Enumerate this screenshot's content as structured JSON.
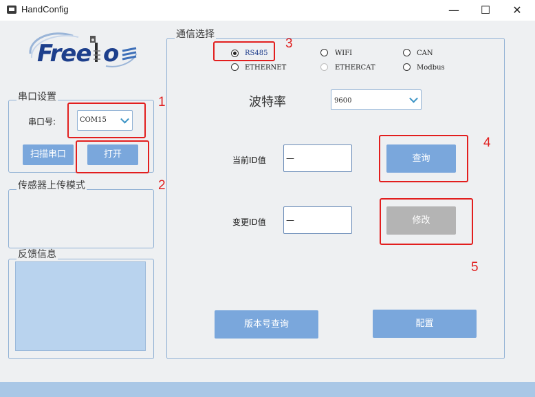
{
  "window": {
    "title": "HandConfig",
    "minimize": "—",
    "maximize": "☐",
    "close": "✕"
  },
  "logo": {
    "text_main": "Free",
    "text_tail": "o"
  },
  "serial": {
    "title": "串口设置",
    "port_label": "串口号:",
    "port_value": "COM15",
    "scan_button": "扫描串口",
    "open_button": "打开"
  },
  "sensor": {
    "title": "传感器上传模式"
  },
  "feedback": {
    "title": "反馈信息"
  },
  "comm": {
    "title": "通信选择",
    "options": [
      {
        "label": "RS485",
        "checked": true
      },
      {
        "label": "WIFI"
      },
      {
        "label": "CAN"
      },
      {
        "label": "ETHERNET"
      },
      {
        "label": "ETHERCAT",
        "disabled": true
      },
      {
        "label": "Modbus"
      }
    ],
    "baud_label": "波特率",
    "baud_value": "9600",
    "current_id_label": "当前ID值",
    "current_id_value": "—",
    "query_button": "查询",
    "change_id_label": "变更ID值",
    "change_id_value": "—",
    "modify_button": "修改",
    "version_button": "版本号查询",
    "config_button": "配置"
  },
  "annotations": [
    "1",
    "2",
    "3",
    "4",
    "5"
  ],
  "colors": {
    "accent_button": "#7aa7dc",
    "disabled_button": "#b4b4b4",
    "annotation_red": "#e21e1e",
    "group_border": "#8fb0d4"
  }
}
